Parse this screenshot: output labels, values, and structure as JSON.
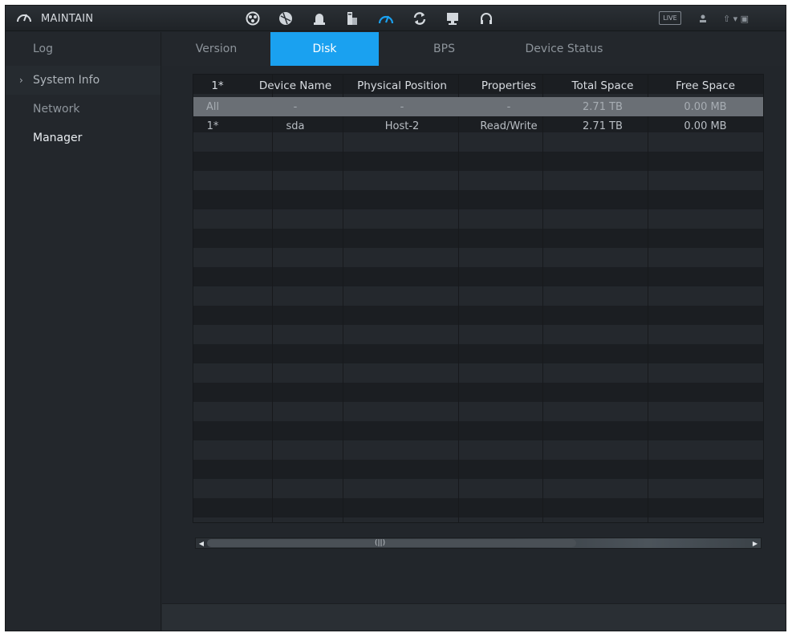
{
  "topbar": {
    "title": "MAINTAIN",
    "live_label": "LIVE",
    "icons": [
      "search-icon",
      "ball-icon",
      "alarm-icon",
      "storage-icon",
      "maintain-icon",
      "backup-icon",
      "display-icon",
      "audio-icon"
    ],
    "right_text": "⇧ ▾ ▣"
  },
  "sidebar": {
    "log_label": "Log",
    "group_label": "System Info",
    "items": [
      {
        "label": "Network"
      },
      {
        "label": "Manager"
      }
    ]
  },
  "tabs": [
    {
      "label": "Version"
    },
    {
      "label": "Disk"
    },
    {
      "label": "BPS"
    },
    {
      "label": "Device Status"
    }
  ],
  "table": {
    "headers": [
      "1*",
      "Device Name",
      "Physical Position",
      "Properties",
      "Total Space",
      "Free Space"
    ],
    "all_row": [
      "All",
      "-",
      "-",
      "-",
      "2.71 TB",
      "0.00 MB"
    ],
    "rows": [
      [
        "1*",
        "sda",
        "Host-2",
        "Read/Write",
        "2.71 TB",
        "0.00 MB"
      ]
    ]
  },
  "scrollbar": {
    "grip": "(||)"
  },
  "colors": {
    "accent": "#1aa1f0",
    "background": "#22262b"
  }
}
